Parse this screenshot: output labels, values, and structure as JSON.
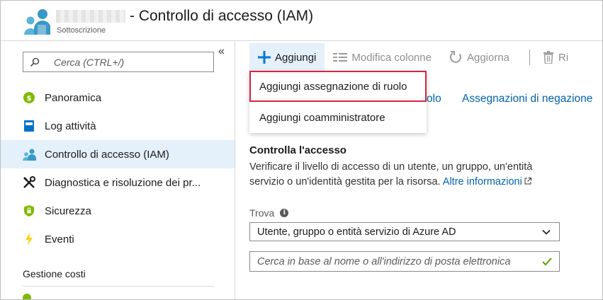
{
  "header": {
    "title": "- Controllo di accesso (IAM)",
    "subtitle": "Sottoscrizione"
  },
  "sidebar": {
    "collapse_label": "«",
    "search_placeholder": "Cerca (CTRL+/)",
    "items": [
      {
        "label": "Panoramica",
        "icon": "overview-icon"
      },
      {
        "label": "Log attività",
        "icon": "activity-log-icon"
      },
      {
        "label": "Controllo di accesso (IAM)",
        "icon": "iam-icon",
        "active": true
      },
      {
        "label": "Diagnostica e risoluzione dei pr...",
        "icon": "diagnose-icon"
      },
      {
        "label": "Sicurezza",
        "icon": "security-shield-icon"
      },
      {
        "label": "Eventi",
        "icon": "events-bolt-icon"
      }
    ],
    "section_title": "Gestione costi"
  },
  "toolbar": {
    "add_label": "Aggiungi",
    "edit_columns_label": "Modifica colonne",
    "refresh_label": "Aggiorna",
    "remove_label": "Ri"
  },
  "dropdown": {
    "items": [
      "Aggiungi assegnazione di ruolo",
      "Aggiungi coamministratore"
    ]
  },
  "tabs": {
    "peek_left": "olo",
    "deny_assignments": "Assegnazioni di negazione"
  },
  "content": {
    "title": "Controlla l'accesso",
    "description": "Verificare il livello di accesso di un utente, un gruppo, un'entità servizio o un'identità gestita per la risorsa.",
    "learn_more": "Altre informazioni",
    "find_label": "Trova",
    "select_value": "Utente, gruppo o entità servizio di Azure AD",
    "search_placeholder": "Cerca in base al nome o all'indirizzo di posta elettronica"
  },
  "colors": {
    "accent": "#0078d4",
    "active_bg": "#e4f0fa",
    "highlight_border": "#d7263d",
    "link": "#0063b1"
  }
}
